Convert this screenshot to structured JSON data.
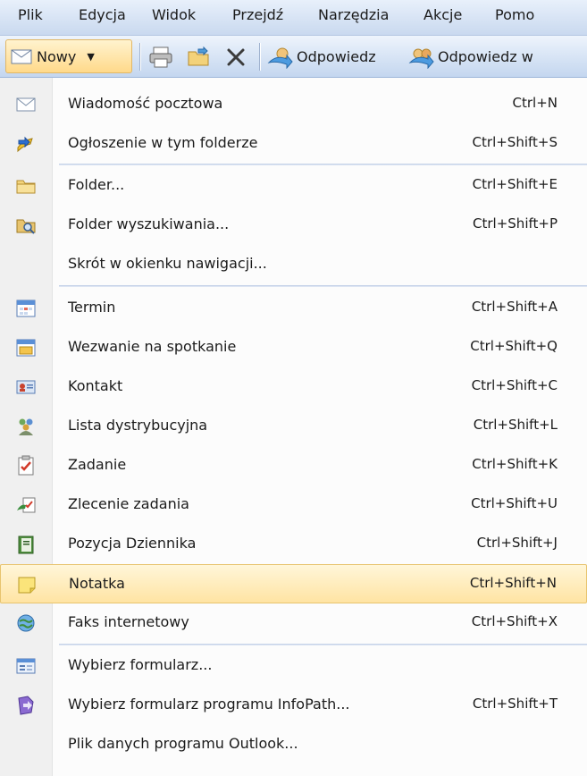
{
  "menubar": {
    "items": [
      "Plik",
      "Edycja",
      "Widok",
      "Przejdź",
      "Narzędzia",
      "Akcje",
      "Pomo"
    ]
  },
  "toolbar": {
    "new_label": "Nowy",
    "reply_label": "Odpowiedz",
    "reply_all_label": "Odpowiedz w"
  },
  "menu": {
    "items": [
      {
        "label": "Wiadomość pocztowa",
        "shortcut": "Ctrl+N",
        "icon": "mail-message-icon"
      },
      {
        "label": "Ogłoszenie w tym folderze",
        "shortcut": "Ctrl+Shift+S",
        "icon": "post-icon"
      },
      {
        "label": "Folder...",
        "shortcut": "Ctrl+Shift+E",
        "icon": "folder-icon"
      },
      {
        "label": "Folder wyszukiwania...",
        "shortcut": "Ctrl+Shift+P",
        "icon": "search-folder-icon"
      },
      {
        "label": "Skrót w okienku nawigacji...",
        "shortcut": "",
        "icon": ""
      },
      {
        "label": "Termin",
        "shortcut": "Ctrl+Shift+A",
        "icon": "appointment-icon"
      },
      {
        "label": "Wezwanie na spotkanie",
        "shortcut": "Ctrl+Shift+Q",
        "icon": "meeting-icon"
      },
      {
        "label": "Kontakt",
        "shortcut": "Ctrl+Shift+C",
        "icon": "contact-icon"
      },
      {
        "label": "Lista dystrybucyjna",
        "shortcut": "Ctrl+Shift+L",
        "icon": "distribution-list-icon"
      },
      {
        "label": "Zadanie",
        "shortcut": "Ctrl+Shift+K",
        "icon": "task-icon"
      },
      {
        "label": "Zlecenie zadania",
        "shortcut": "Ctrl+Shift+U",
        "icon": "task-request-icon"
      },
      {
        "label": "Pozycja Dziennika",
        "shortcut": "Ctrl+Shift+J",
        "icon": "journal-icon"
      },
      {
        "label": "Notatka",
        "shortcut": "Ctrl+Shift+N",
        "icon": "note-icon"
      },
      {
        "label": "Faks internetowy",
        "shortcut": "Ctrl+Shift+X",
        "icon": "fax-icon"
      },
      {
        "label": "Wybierz formularz...",
        "shortcut": "",
        "icon": "form-icon"
      },
      {
        "label": "Wybierz formularz programu InfoPath...",
        "shortcut": "Ctrl+Shift+T",
        "icon": "infopath-icon"
      },
      {
        "label": "Plik danych programu Outlook...",
        "shortcut": "",
        "icon": ""
      }
    ]
  }
}
